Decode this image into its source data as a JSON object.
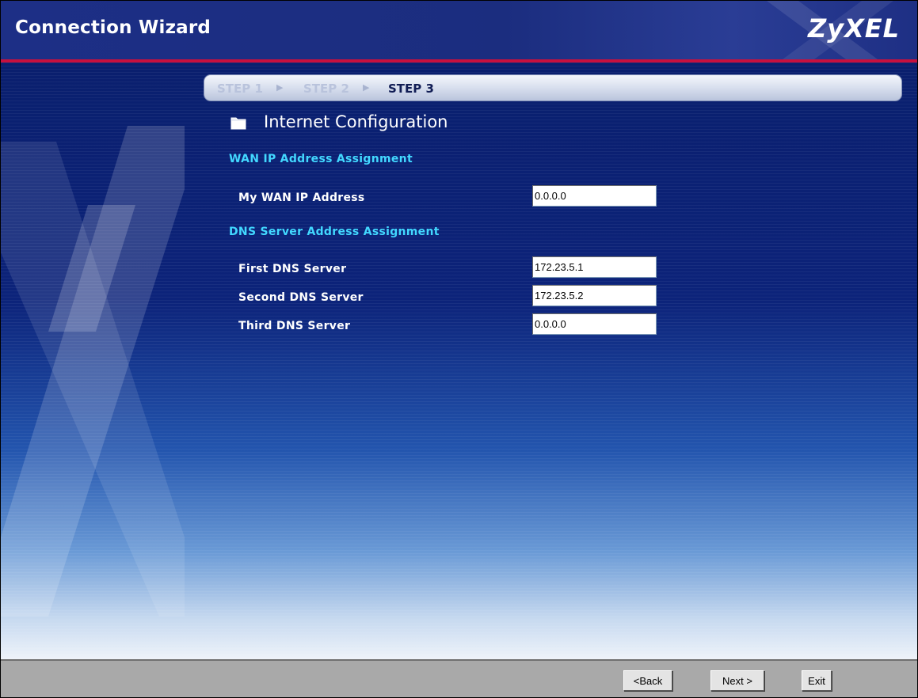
{
  "header": {
    "title": "Connection Wizard",
    "logo_text": "ZyXEL",
    "accent_color": "#c8103e"
  },
  "steps": [
    {
      "label": "STEP 1",
      "state": "inactive"
    },
    {
      "label": "STEP 2",
      "state": "inactive"
    },
    {
      "label": "STEP 3",
      "state": "active"
    }
  ],
  "section": {
    "title": "Internet Configuration",
    "icon": "folder-icon"
  },
  "wan": {
    "heading": "WAN IP Address Assignment",
    "my_wan_ip": {
      "label": "My WAN IP Address",
      "value": "0.0.0.0"
    }
  },
  "dns": {
    "heading": "DNS Server Address Assignment",
    "first": {
      "label": "First DNS Server",
      "value": "172.23.5.1"
    },
    "second": {
      "label": "Second DNS Server",
      "value": "172.23.5.2"
    },
    "third": {
      "label": "Third DNS Server",
      "value": "0.0.0.0"
    }
  },
  "footer": {
    "back_label": "<Back",
    "next_label": "Next >",
    "exit_label": "Exit"
  }
}
